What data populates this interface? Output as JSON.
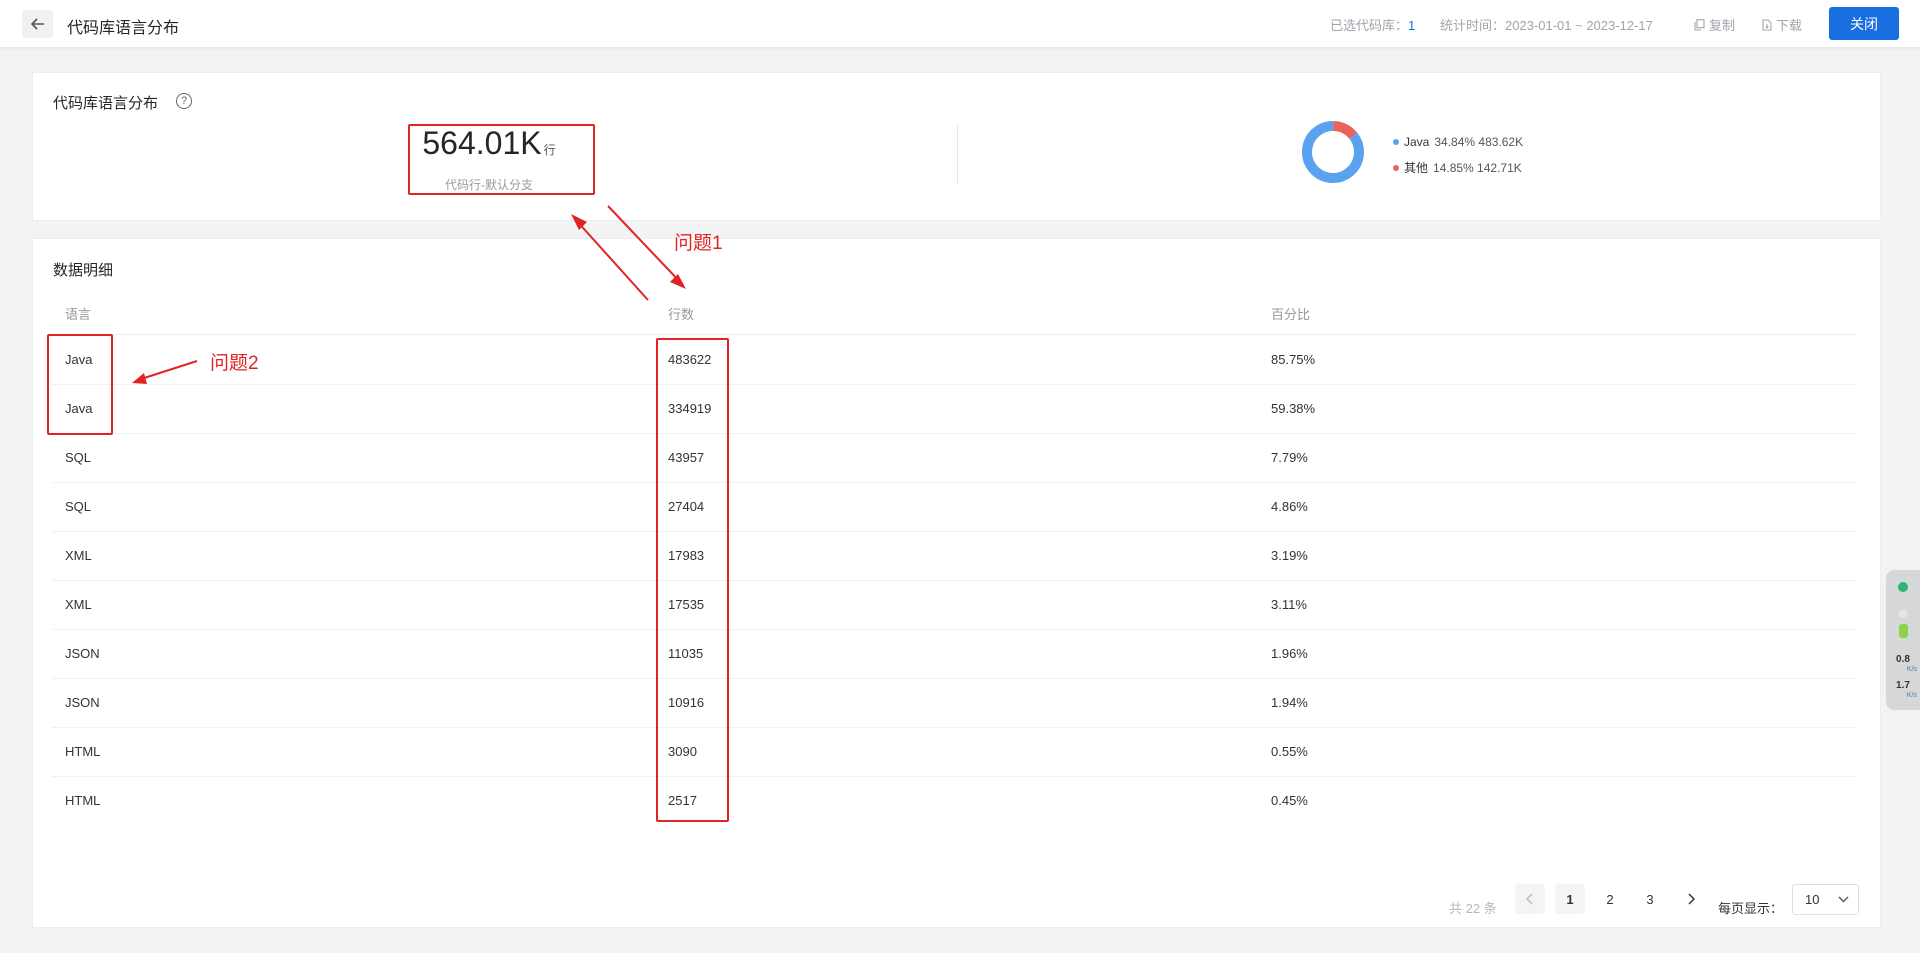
{
  "header": {
    "title": "代码库语言分布",
    "selected_label": "已选代码库：",
    "selected_value": "1",
    "time_label": "统计时间：",
    "time_value": "2023-01-01 ~ 2023-12-17",
    "copy_label": "复制",
    "download_label": "下载",
    "close_label": "关闭"
  },
  "summary": {
    "title": "代码库语言分布",
    "help": "?",
    "total": "564.01K",
    "unit": "行",
    "subtitle": "代码行-默认分支"
  },
  "donut": {
    "legend": [
      {
        "name": "Java",
        "meta": "34.84% 483.62K",
        "color": "#5aa1f0"
      },
      {
        "name": "其他",
        "meta": "14.85% 142.71K",
        "color": "#e8645a"
      }
    ],
    "slices": [
      {
        "name": "Java",
        "fraction": 0.8575,
        "color": "#5aa1f0"
      },
      {
        "name": "其他",
        "fraction": 0.1425,
        "color": "#e8645a"
      }
    ]
  },
  "table": {
    "title": "数据明细",
    "columns": [
      "语言",
      "行数",
      "百分比"
    ],
    "rows": [
      {
        "lang": "Java",
        "lines": "483622",
        "pct": "85.75%"
      },
      {
        "lang": "Java",
        "lines": "334919",
        "pct": "59.38%"
      },
      {
        "lang": "SQL",
        "lines": "43957",
        "pct": "7.79%"
      },
      {
        "lang": "SQL",
        "lines": "27404",
        "pct": "4.86%"
      },
      {
        "lang": "XML",
        "lines": "17983",
        "pct": "3.19%"
      },
      {
        "lang": "XML",
        "lines": "17535",
        "pct": "3.11%"
      },
      {
        "lang": "JSON",
        "lines": "11035",
        "pct": "1.96%"
      },
      {
        "lang": "JSON",
        "lines": "10916",
        "pct": "1.94%"
      },
      {
        "lang": "HTML",
        "lines": "3090",
        "pct": "0.55%"
      },
      {
        "lang": "HTML",
        "lines": "2517",
        "pct": "0.45%"
      }
    ]
  },
  "pagination": {
    "total": "共 22 条",
    "prev": "‹",
    "pages": [
      "1",
      "2",
      "3"
    ],
    "current": "1",
    "next": "›",
    "page_size_label": "每页显示：",
    "page_size": "10"
  },
  "annotations": {
    "issue1": "问题1",
    "issue2": "问题2"
  },
  "side_widget": {
    "up_value": "0.8",
    "up_unit": "K/s",
    "down_value": "1.7",
    "down_unit": "K/s"
  }
}
